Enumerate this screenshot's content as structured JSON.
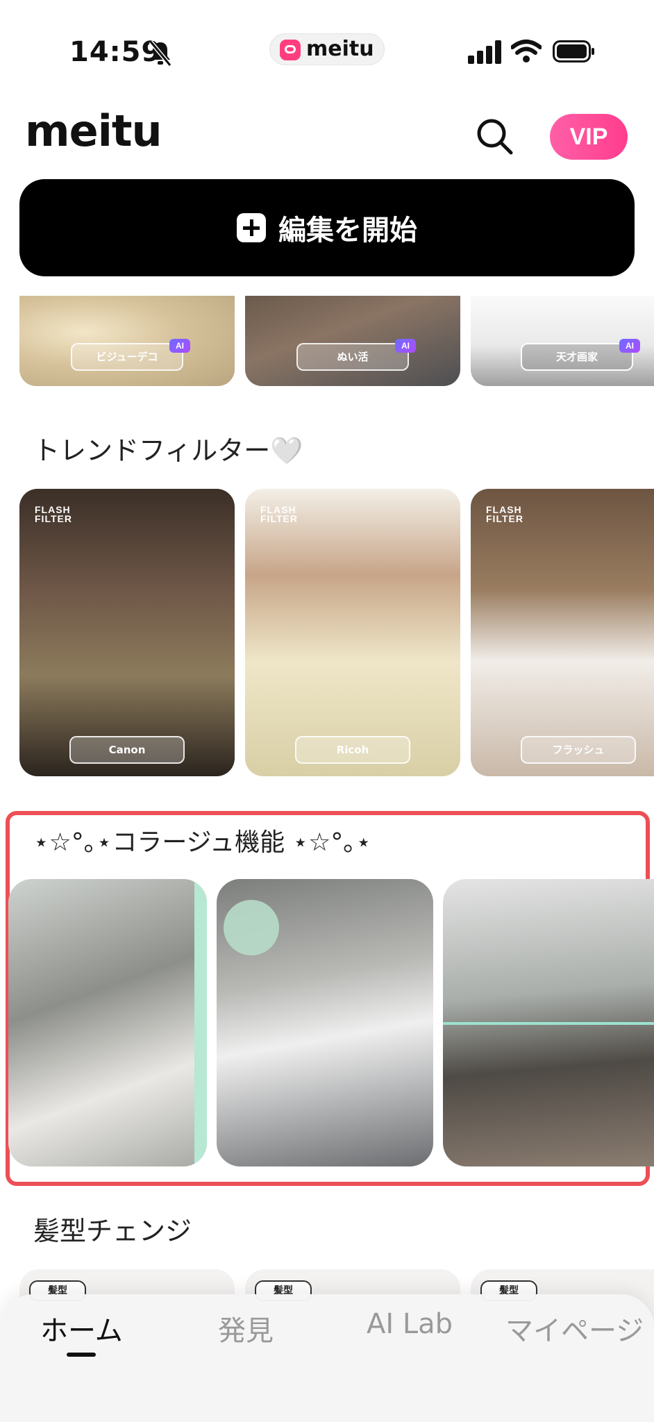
{
  "status_bar": {
    "time": "14:59",
    "app_name": "meitu"
  },
  "header": {
    "logo": "meitu",
    "vip_label": "VIP"
  },
  "start_edit": {
    "label": "編集を開始"
  },
  "features": [
    {
      "label": "ビジューデコ",
      "badge": "AI"
    },
    {
      "label": "ぬい活",
      "badge": "AI"
    },
    {
      "label": "天才画家",
      "badge": "AI"
    }
  ],
  "trend_filters": {
    "title": "トレンドフィルター🤍",
    "tag": "FLASH\nFILTER",
    "items": [
      {
        "label": "Canon"
      },
      {
        "label": "Ricoh"
      },
      {
        "label": "フラッシュ"
      }
    ]
  },
  "collage": {
    "title": "⋆☆°｡⋆コラージュ機能 ⋆☆°｡⋆"
  },
  "hair": {
    "title": "髪型チェンジ",
    "tag": "髪型"
  },
  "bottom_nav": {
    "items": [
      {
        "label": "ホーム",
        "active": true
      },
      {
        "label": "発見",
        "active": false
      },
      {
        "label": "AI Lab",
        "active": false
      },
      {
        "label": "マイページ",
        "active": false
      }
    ]
  }
}
